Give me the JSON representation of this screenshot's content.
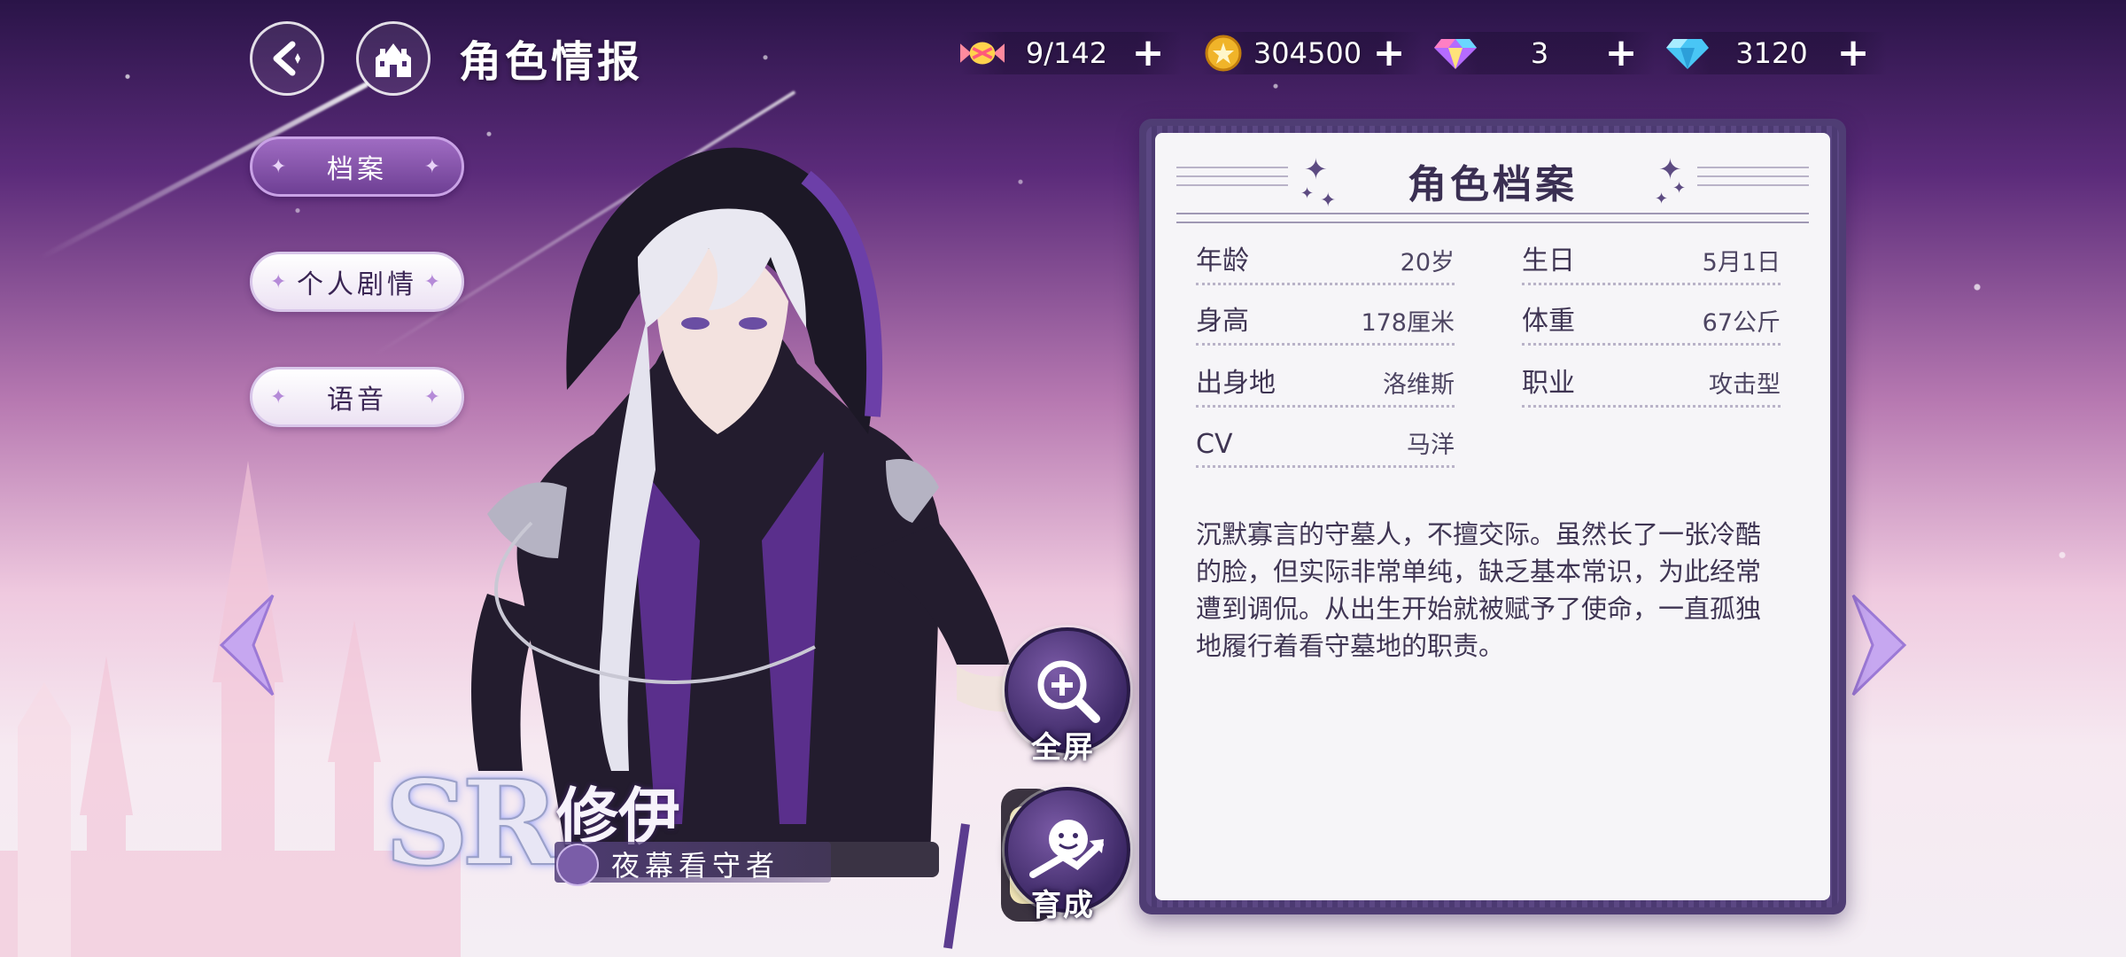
{
  "header": {
    "title": "角色情报",
    "back_icon": "back-arrow-icon",
    "home_icon": "castle-home-icon"
  },
  "currencies": [
    {
      "icon": "candy-icon",
      "value": "9/142",
      "plus": "+"
    },
    {
      "icon": "gold-coin-icon",
      "value": "304500",
      "plus": "+"
    },
    {
      "icon": "rainbow-gem-icon",
      "value": "3",
      "plus": "+"
    },
    {
      "icon": "blue-diamond-icon",
      "value": "3120",
      "plus": "+"
    }
  ],
  "side_menu": [
    {
      "label": "档案",
      "active": true
    },
    {
      "label": "个人剧情",
      "active": false
    },
    {
      "label": "语音",
      "active": false
    }
  ],
  "character": {
    "rarity": "SR",
    "name": "修伊",
    "title": "夜幕看守者"
  },
  "actions": {
    "fullscreen_label": "全屏",
    "upgrade_label": "育成"
  },
  "profile": {
    "panel_title": "角色档案",
    "stats": [
      {
        "key": "年龄",
        "value": "20岁"
      },
      {
        "key": "生日",
        "value": "5月1日"
      },
      {
        "key": "身高",
        "value": "178厘米"
      },
      {
        "key": "体重",
        "value": "67公斤"
      },
      {
        "key": "出身地",
        "value": "洛维斯"
      },
      {
        "key": "职业",
        "value": "攻击型"
      },
      {
        "key": "CV",
        "value": "马洋"
      }
    ],
    "bio_lines": [
      "沉默寡言的守墓人，不擅交际。虽然长了一张冷酷",
      "的脸，但实际非常单纯，缺乏基本常识，为此经常",
      "遭到调侃。从出生开始就被赋予了使命，一直孤独",
      "地履行着看守墓地的职责。"
    ]
  },
  "colors": {
    "accent_purple": "#6e3f94",
    "panel_frame": "#4f3d74",
    "panel_bg": "#f6f5f8"
  }
}
